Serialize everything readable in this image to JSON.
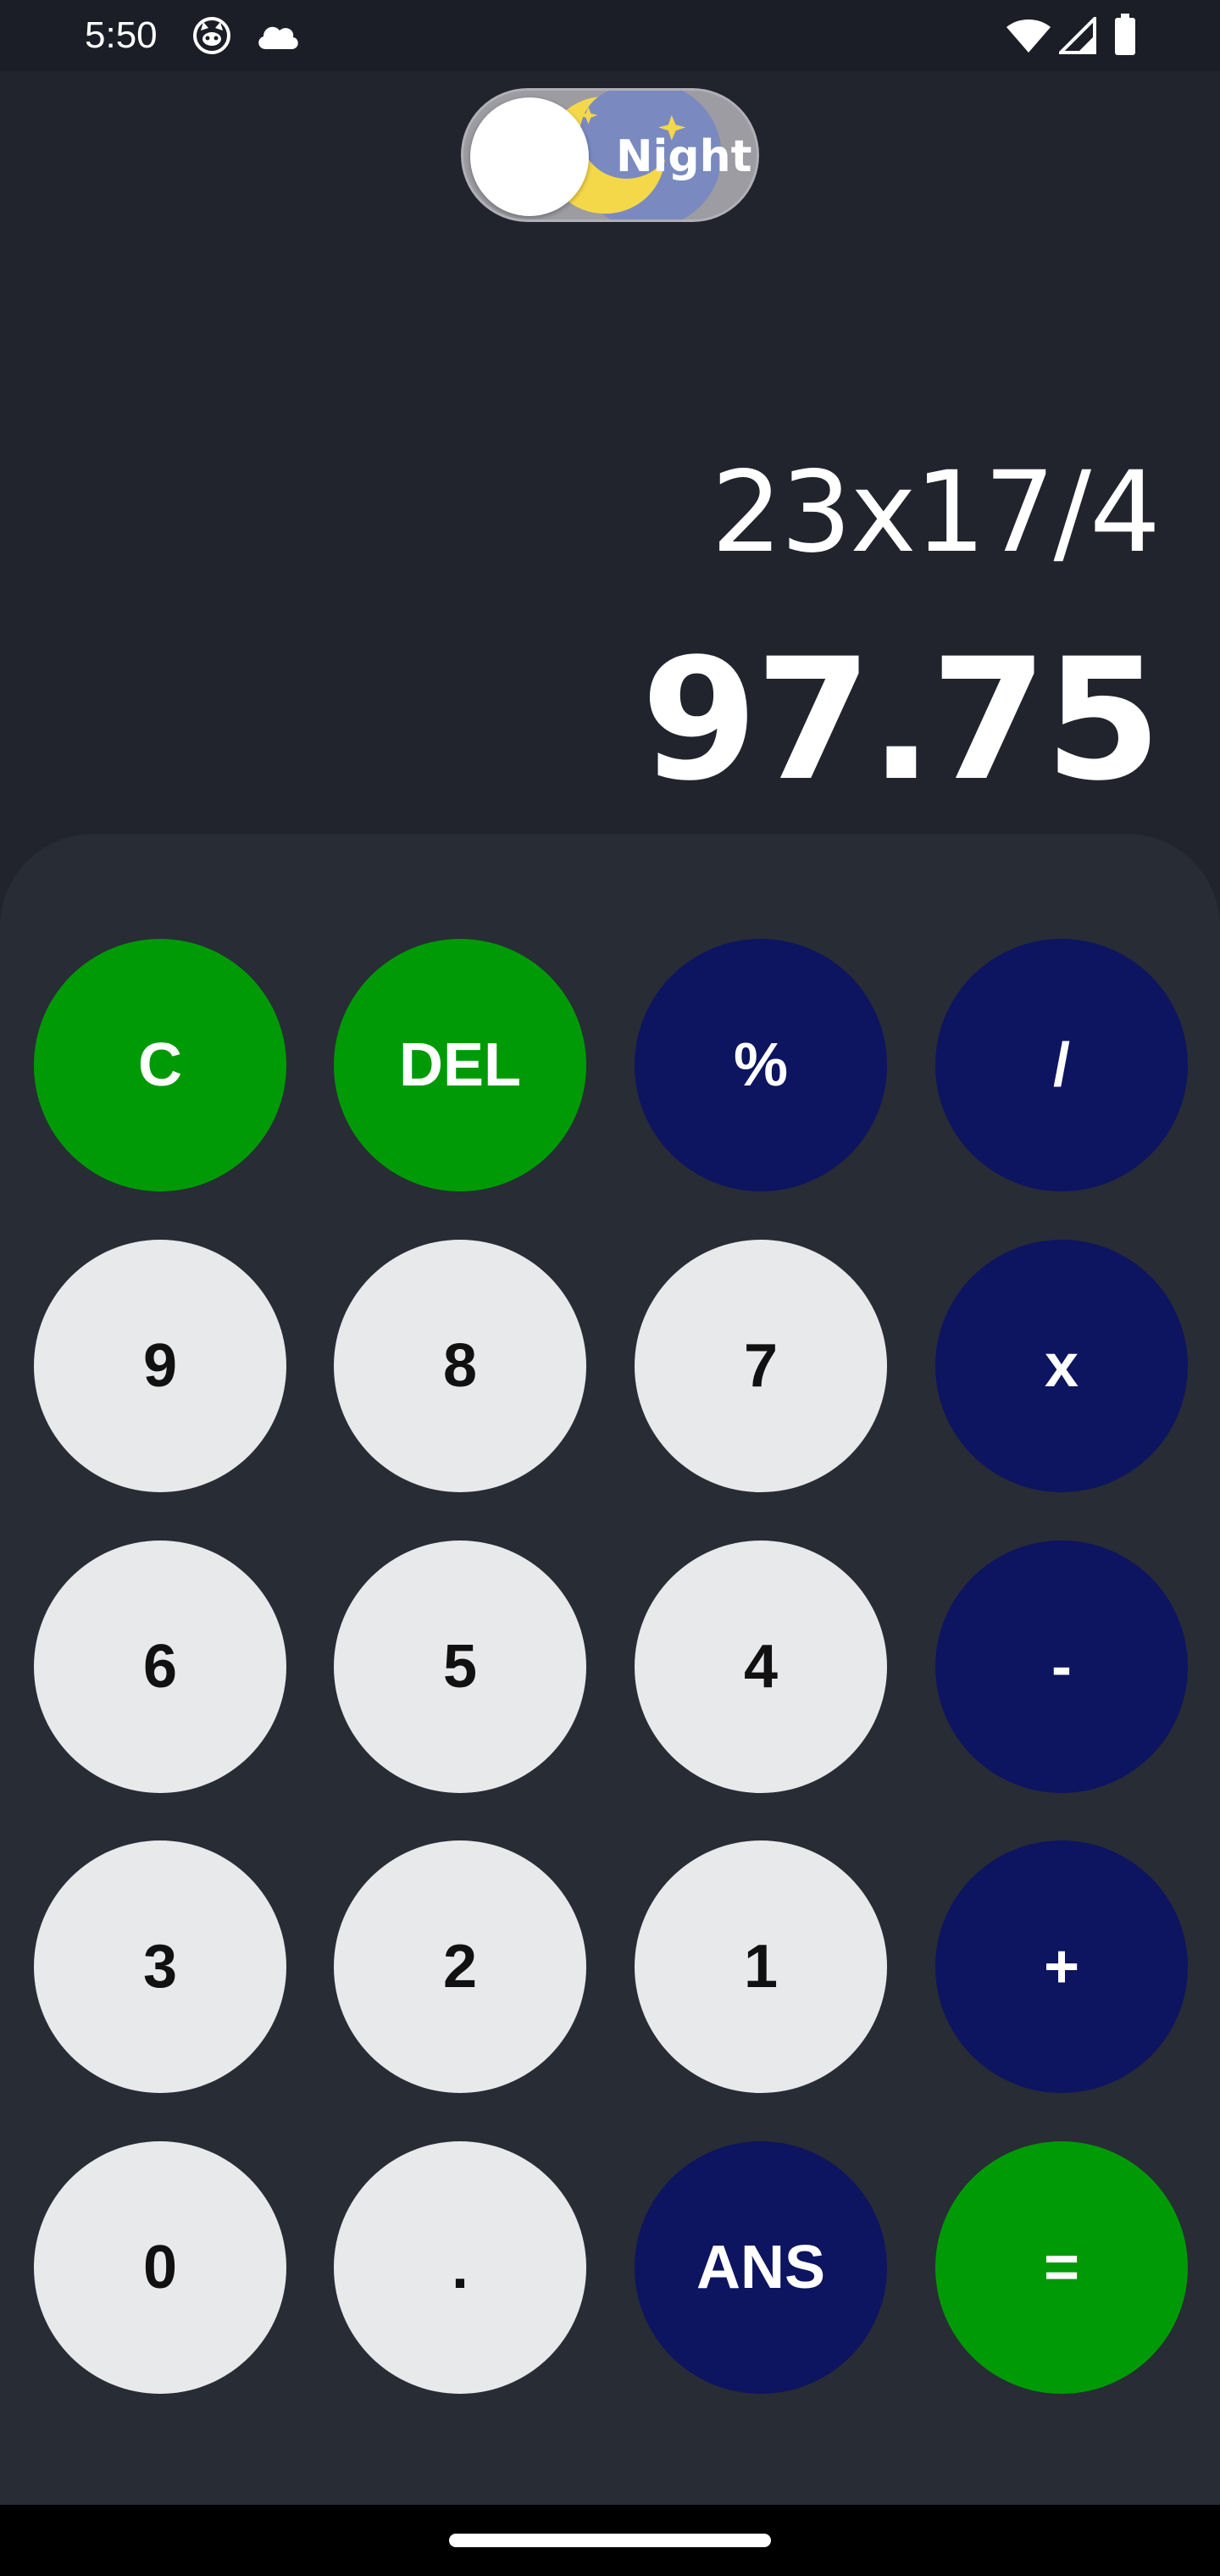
{
  "status_bar": {
    "time": "5:50",
    "left_icons": [
      "cat-face-icon",
      "cloud-icon"
    ],
    "right_icons": [
      "wifi-icon",
      "signal-icon",
      "battery-icon"
    ]
  },
  "theme_toggle": {
    "label": "Night",
    "state": "night"
  },
  "display": {
    "expression": "23x17/4",
    "result": "97.75"
  },
  "keypad": {
    "rows": [
      [
        {
          "label": "C",
          "kind": "action",
          "name": "clear-button"
        },
        {
          "label": "DEL",
          "kind": "action",
          "name": "delete-button"
        },
        {
          "label": "%",
          "kind": "operator",
          "name": "percent-button"
        },
        {
          "label": "/",
          "kind": "operator",
          "name": "divide-button"
        }
      ],
      [
        {
          "label": "9",
          "kind": "digit",
          "name": "digit-9-button"
        },
        {
          "label": "8",
          "kind": "digit",
          "name": "digit-8-button"
        },
        {
          "label": "7",
          "kind": "digit",
          "name": "digit-7-button"
        },
        {
          "label": "x",
          "kind": "operator",
          "name": "multiply-button"
        }
      ],
      [
        {
          "label": "6",
          "kind": "digit",
          "name": "digit-6-button"
        },
        {
          "label": "5",
          "kind": "digit",
          "name": "digit-5-button"
        },
        {
          "label": "4",
          "kind": "digit",
          "name": "digit-4-button"
        },
        {
          "label": "-",
          "kind": "operator",
          "name": "subtract-button"
        }
      ],
      [
        {
          "label": "3",
          "kind": "digit",
          "name": "digit-3-button"
        },
        {
          "label": "2",
          "kind": "digit",
          "name": "digit-2-button"
        },
        {
          "label": "1",
          "kind": "digit",
          "name": "digit-1-button"
        },
        {
          "label": "+",
          "kind": "operator",
          "name": "add-button"
        }
      ],
      [
        {
          "label": "0",
          "kind": "digit",
          "name": "digit-0-button"
        },
        {
          "label": ".",
          "kind": "digit",
          "name": "decimal-point-button"
        },
        {
          "label": "ANS",
          "kind": "operator",
          "name": "answer-button"
        },
        {
          "label": "=",
          "kind": "action",
          "name": "equals-button"
        }
      ]
    ]
  },
  "colors": {
    "background": "#21242d",
    "keypad_panel": "#282c35",
    "digit_key": "#e8e9eb",
    "operator_key": "#0d1460",
    "action_key": "#009a06",
    "toggle_sun": "#f5d84a",
    "toggle_sky": "#7a8ac0"
  }
}
